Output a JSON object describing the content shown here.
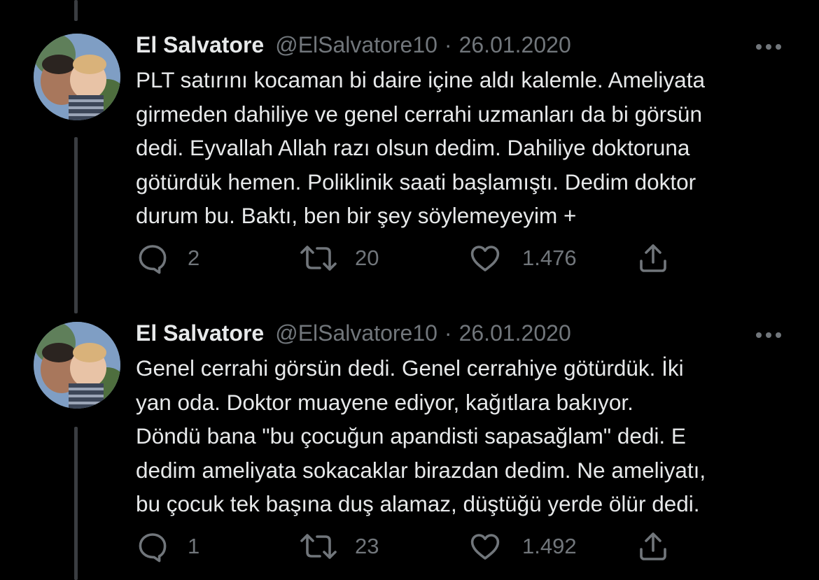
{
  "tweets": [
    {
      "author_name": "El Salvatore",
      "handle": "@ElSalvatore10",
      "separator": "·",
      "date": "26.01.2020",
      "lines": [
        "PLT satırını kocaman bi daire içine aldı kalemle. Ameliyata",
        "girmeden dahiliye ve genel cerrahi uzmanları da bi görsün",
        "dedi. Eyvallah Allah razı olsun dedim. Dahiliye doktoruna",
        "götürdük hemen. Poliklinik saati başlamıştı. Dedim doktor",
        "durum bu. Baktı, ben bir şey söylemeyeyim +"
      ],
      "replies": "2",
      "retweets": "20",
      "likes": "1.476"
    },
    {
      "author_name": "El Salvatore",
      "handle": "@ElSalvatore10",
      "separator": "·",
      "date": "26.01.2020",
      "lines": [
        "Genel cerrahi görsün dedi. Genel cerrahiye götürdük. İki",
        "yan oda. Doktor muayene ediyor, kağıtlara bakıyor.",
        "Döndü bana \"bu çocuğun apandisti sapasağlam\" dedi. E",
        "dedim ameliyata sokacaklar birazdan dedim. Ne ameliyatı,",
        "bu çocuk tek başına duş alamaz, düştüğü yerde ölür dedi."
      ],
      "replies": "1",
      "retweets": "23",
      "likes": "1.492"
    }
  ],
  "icons": {
    "reply": "reply-icon",
    "retweet": "retweet-icon",
    "like": "like-icon",
    "share": "share-icon",
    "more": "more-options-icon"
  },
  "colors": {
    "background": "#000000",
    "text": "#e7e9ea",
    "secondary": "#71767b",
    "thread_line": "#3a3d41"
  }
}
